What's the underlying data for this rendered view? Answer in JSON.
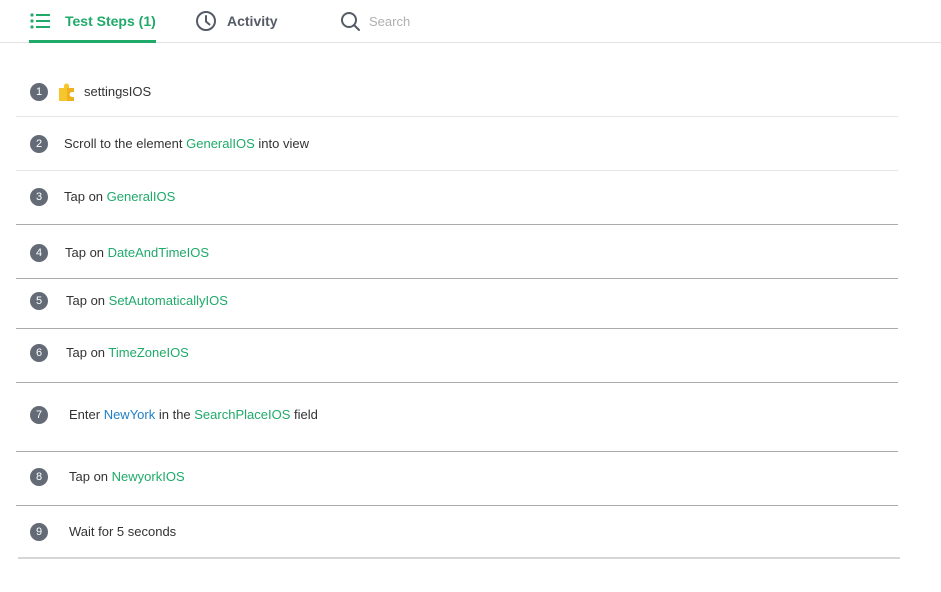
{
  "tabs": {
    "test_steps_label": "Test Steps (1)",
    "activity_label": "Activity",
    "search_placeholder": "Search",
    "search_value": ""
  },
  "colors": {
    "accent": "#1faa6a",
    "value_blue": "#1f7fc4",
    "badge": "#646b76",
    "puzzle": "#f7c52c"
  },
  "steps": [
    {
      "num": "1",
      "icon": "puzzle-icon",
      "parts": [
        {
          "t": "settingsIOS",
          "k": "plain"
        }
      ]
    },
    {
      "num": "2",
      "parts": [
        {
          "t": "Scroll to the element ",
          "k": "plain"
        },
        {
          "t": "GeneralIOS",
          "k": "el"
        },
        {
          "t": " into view",
          "k": "plain"
        }
      ]
    },
    {
      "num": "3",
      "parts": [
        {
          "t": "Tap on ",
          "k": "plain"
        },
        {
          "t": "GeneralIOS",
          "k": "el"
        }
      ]
    },
    {
      "num": "4",
      "parts": [
        {
          "t": "Tap on ",
          "k": "plain"
        },
        {
          "t": "DateAndTimeIOS",
          "k": "el"
        }
      ]
    },
    {
      "num": "5",
      "parts": [
        {
          "t": "Tap on ",
          "k": "plain"
        },
        {
          "t": "SetAutomaticallyIOS",
          "k": "el"
        }
      ]
    },
    {
      "num": "6",
      "parts": [
        {
          "t": "Tap on ",
          "k": "plain"
        },
        {
          "t": "TimeZoneIOS",
          "k": "el"
        }
      ]
    },
    {
      "num": "7",
      "parts": [
        {
          "t": "Enter ",
          "k": "plain"
        },
        {
          "t": "NewYork",
          "k": "val"
        },
        {
          "t": " in the ",
          "k": "plain"
        },
        {
          "t": "SearchPlaceIOS",
          "k": "el"
        },
        {
          "t": " field",
          "k": "plain"
        }
      ]
    },
    {
      "num": "8",
      "parts": [
        {
          "t": "Tap on ",
          "k": "plain"
        },
        {
          "t": "NewyorkIOS",
          "k": "el"
        }
      ]
    },
    {
      "num": "9",
      "parts": [
        {
          "t": "Wait for 5 seconds",
          "k": "plain"
        }
      ]
    }
  ]
}
